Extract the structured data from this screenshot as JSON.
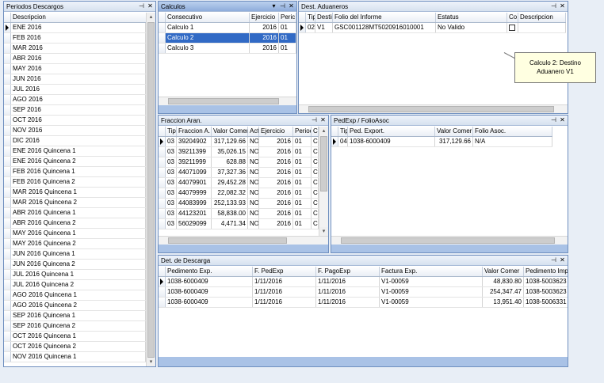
{
  "periodos": {
    "title": "Periodos Descargos",
    "column": "Descripcion",
    "items": [
      "ENE 2016",
      "FEB 2016",
      "MAR 2016",
      "ABR 2016",
      "MAY 2016",
      "JUN 2016",
      "JUL 2016",
      "AGO 2016",
      "SEP 2016",
      "OCT 2016",
      "NOV 2016",
      "DIC 2016",
      "ENE 2016 Quincena 1",
      "ENE 2016 Quincena 2",
      "FEB 2016 Quincena 1",
      "FEB 2016 Quincena 2",
      "MAR 2016 Quincena 1",
      "MAR 2016 Quincena 2",
      "ABR 2016 Quincena 1",
      "ABR 2016 Quincena 2",
      "MAY 2016 Quincena 1",
      "MAY 2016 Quincena 2",
      "JUN 2016 Quincena 1",
      "JUN 2016 Quincena 2",
      "JUL 2016 Quincena 1",
      "JUL 2016 Quincena 2",
      "AGO 2016 Quincena 1",
      "AGO 2016 Quincena 2",
      "SEP 2016 Quincena 1",
      "SEP 2016 Quincena 2",
      "OCT 2016 Quincena 1",
      "OCT 2016 Quincena 2",
      "NOV 2016 Quincena 1"
    ]
  },
  "calculos": {
    "title": "Calculos",
    "columns": [
      "Consecutivo",
      "Ejercicio",
      "Peric"
    ],
    "rows": [
      [
        "Calculo 1",
        "2016",
        "01"
      ],
      [
        "Calculo 2",
        "2016",
        "01"
      ],
      [
        "Calculo 3",
        "2016",
        "01"
      ]
    ]
  },
  "aduaneros": {
    "title": "Dest. Aduaneros",
    "columns": [
      "Tip",
      "Destir",
      "Folio del Informe",
      "Estatus",
      "Co",
      "Descripcion"
    ],
    "rows": [
      [
        "02",
        "V1",
        "GSC001128MT5020916010001",
        "No Valido",
        "",
        ""
      ]
    ]
  },
  "tooltip": {
    "line1": "Calculo 2: Destino",
    "line2": "Aduanero V1"
  },
  "fraccion": {
    "title": "Fraccion Aran.",
    "columns": [
      "Tip",
      "Fraccion A.",
      "Valor Comer",
      "Act",
      "Ejercicio",
      "Perioc",
      "C"
    ],
    "rows": [
      [
        "03",
        "39204902",
        "317,129.66",
        "NO",
        "2016",
        "01",
        "C"
      ],
      [
        "03",
        "39211399",
        "35,026.15",
        "NO",
        "2016",
        "01",
        "C"
      ],
      [
        "03",
        "39211999",
        "628.88",
        "NO",
        "2016",
        "01",
        "C"
      ],
      [
        "03",
        "44071099",
        "37,327.36",
        "NO",
        "2016",
        "01",
        "C"
      ],
      [
        "03",
        "44079901",
        "29,452.28",
        "NO",
        "2016",
        "01",
        "C"
      ],
      [
        "03",
        "44079999",
        "22,082.32",
        "NO",
        "2016",
        "01",
        "C"
      ],
      [
        "03",
        "44083999",
        "252,133.93",
        "NO",
        "2016",
        "01",
        "C"
      ],
      [
        "03",
        "44123201",
        "58,838.00",
        "NO",
        "2016",
        "01",
        "C"
      ],
      [
        "03",
        "56029099",
        "4,471.34",
        "NO",
        "2016",
        "01",
        "C"
      ]
    ]
  },
  "pedexp": {
    "title": "PedExp / FolioAsoc",
    "columns": [
      "Tip",
      "Ped. Export.",
      "Valor Comer",
      "Folio Asoc."
    ],
    "rows": [
      [
        "04",
        "1038-6000409",
        "317,129.66",
        "N/A"
      ]
    ]
  },
  "descarga": {
    "title": "Det. de Descarga",
    "columns": [
      "Pedimento Exp.",
      "F. PedExp",
      "F. PagoExp",
      "Factura Exp.",
      "Valor Comer",
      "Pedimento Imp."
    ],
    "rows": [
      [
        "1038-6000409",
        "1/11/2016",
        "1/11/2016",
        "V1-00059",
        "48,830.80",
        "1038-5003623"
      ],
      [
        "1038-6000409",
        "1/11/2016",
        "1/11/2016",
        "V1-00059",
        "254,347.47",
        "1038-5003623"
      ],
      [
        "1038-6000409",
        "1/11/2016",
        "1/11/2016",
        "V1-00059",
        "13,951.40",
        "1038-5006331"
      ]
    ]
  },
  "header_icons": {
    "dropdown": "▾",
    "pin": "⊣",
    "close": "✕"
  }
}
